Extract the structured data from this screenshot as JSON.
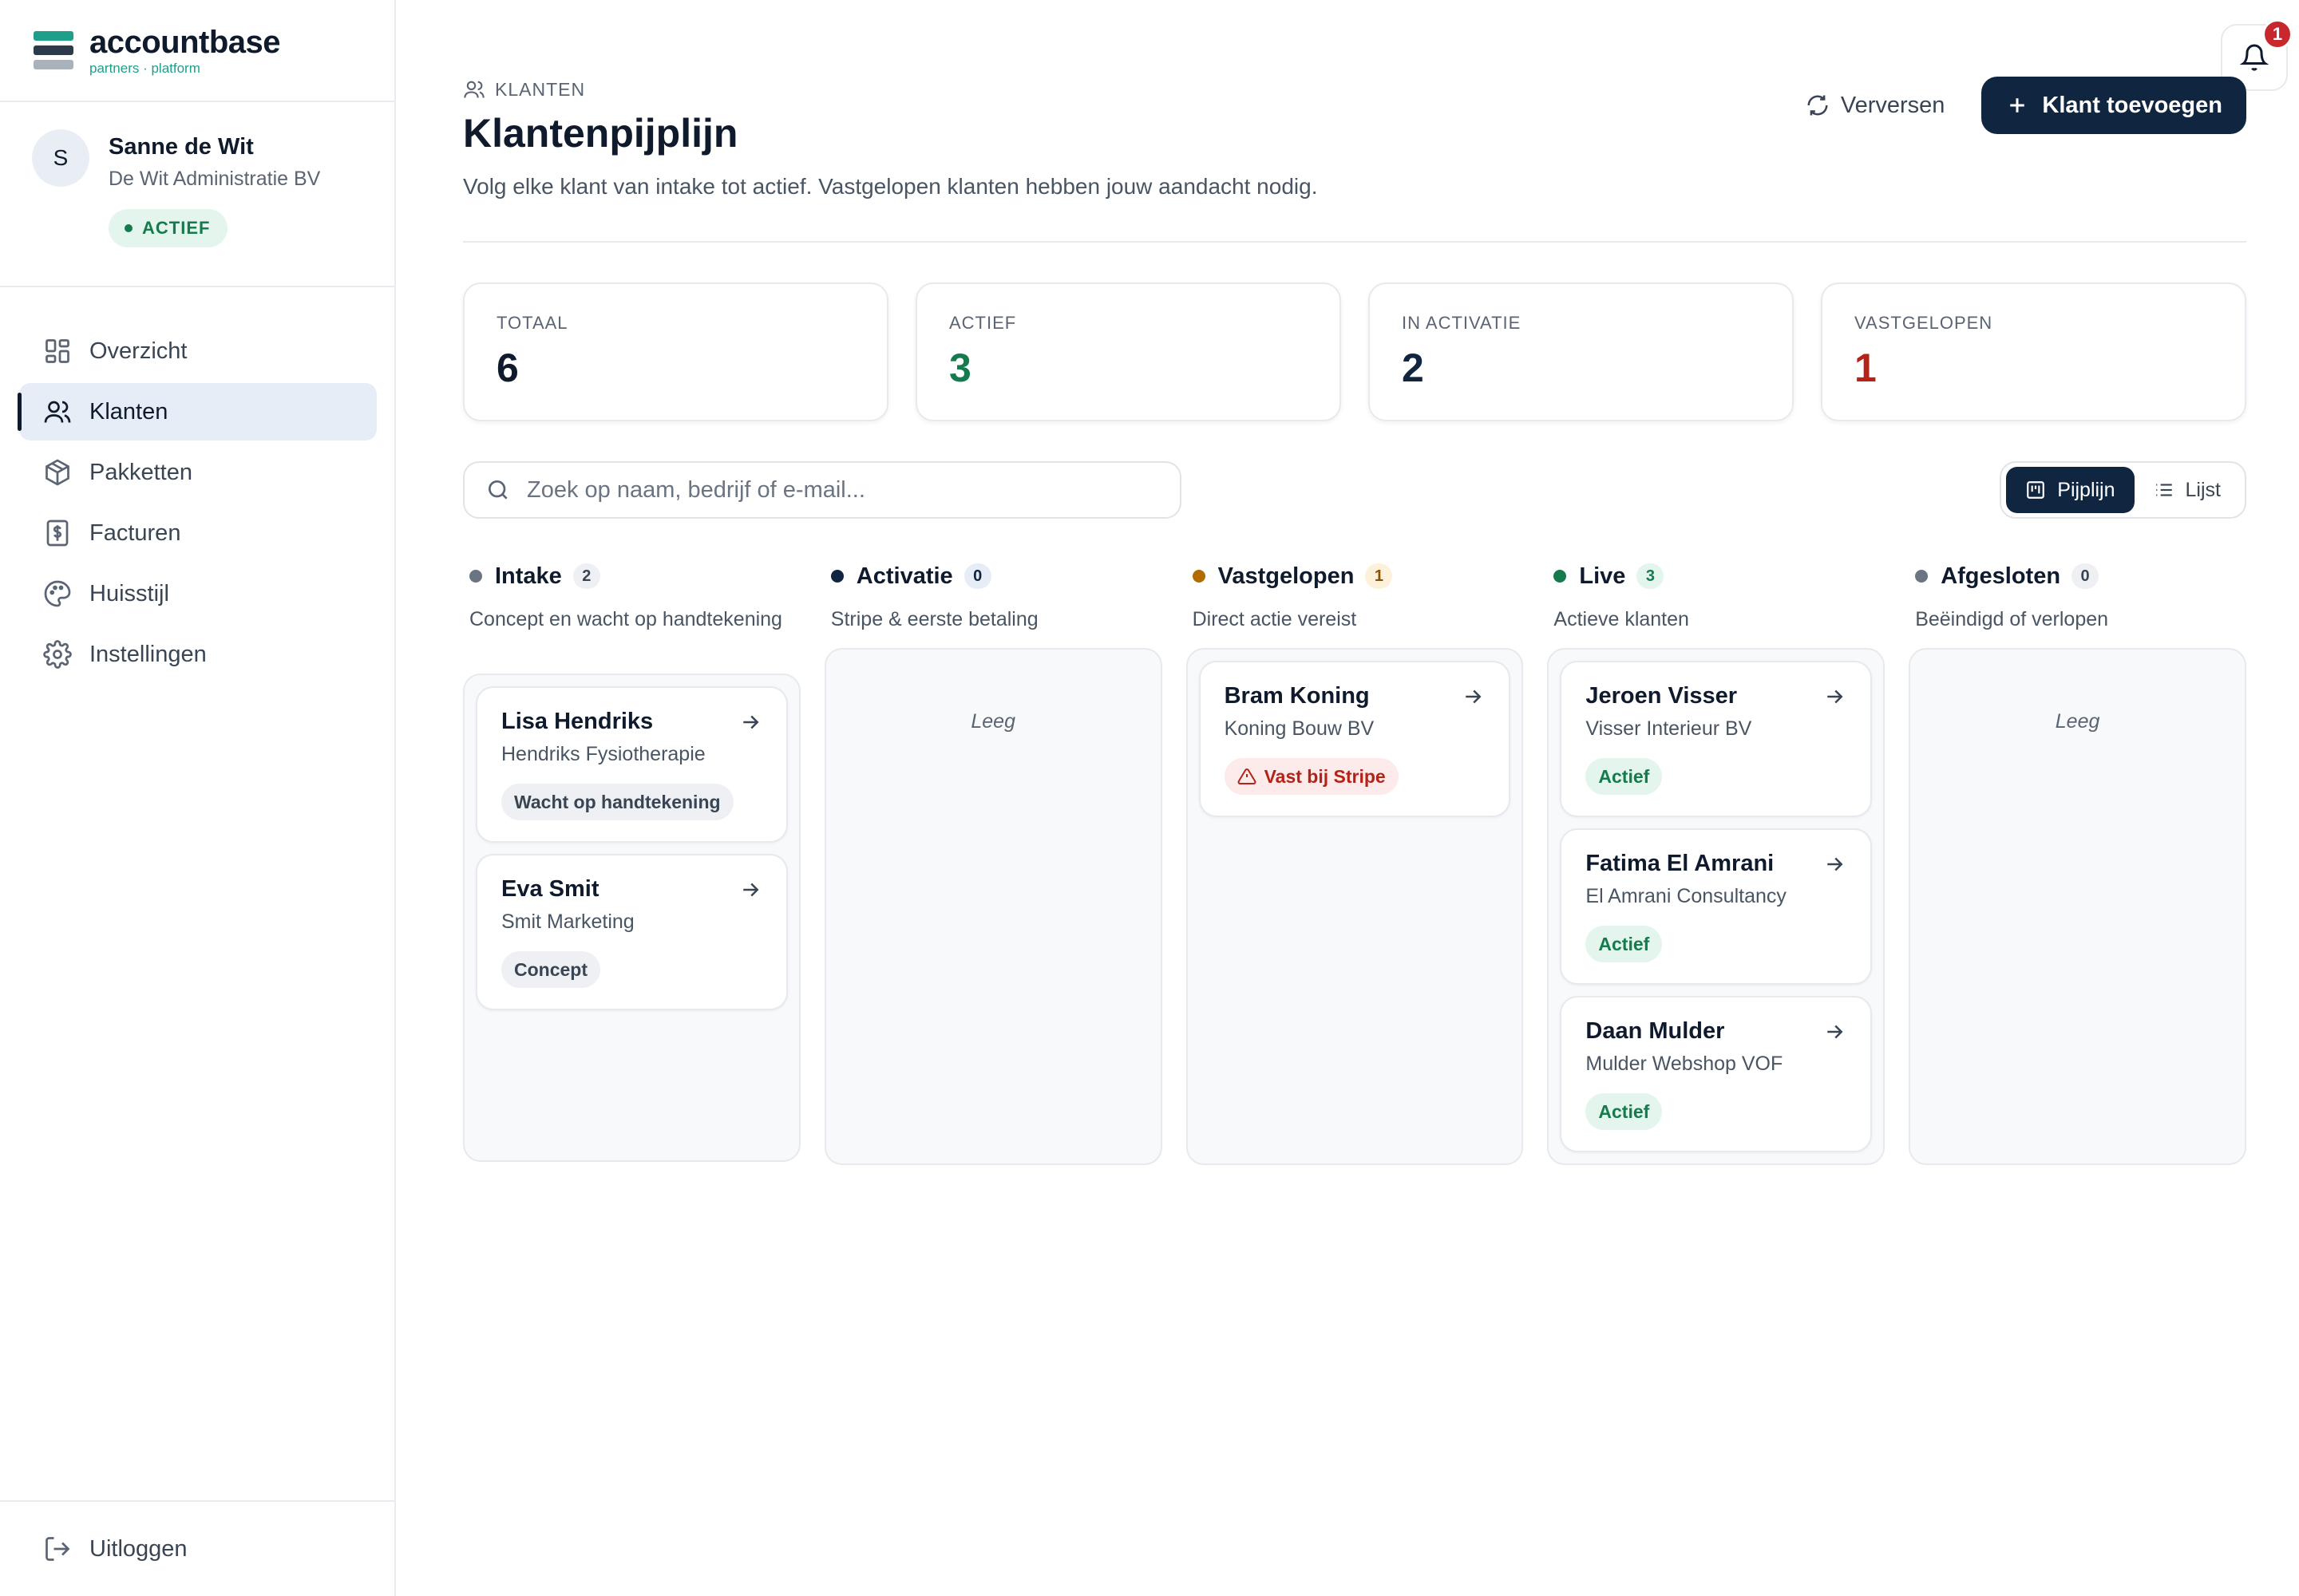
{
  "brand": {
    "name": "accountbase",
    "tagline": "partners · platform"
  },
  "user": {
    "initial": "S",
    "name": "Sanne de Wit",
    "company": "De Wit Administratie BV",
    "status": "ACTIEF"
  },
  "nav": {
    "items": [
      {
        "label": "Overzicht",
        "icon": "dashboard-icon"
      },
      {
        "label": "Klanten",
        "icon": "users-icon",
        "active": true
      },
      {
        "label": "Pakketten",
        "icon": "package-icon"
      },
      {
        "label": "Facturen",
        "icon": "invoice-icon"
      },
      {
        "label": "Huisstijl",
        "icon": "palette-icon"
      },
      {
        "label": "Instellingen",
        "icon": "gear-icon"
      }
    ],
    "logout": "Uitloggen"
  },
  "header": {
    "breadcrumb": "KLANTEN",
    "title": "Klantenpijplijn",
    "subtitle": "Volg elke klant van intake tot actief. Vastgelopen klanten hebben jouw aandacht nodig.",
    "refresh_label": "Verversen",
    "add_label": "Klant toevoegen",
    "notification_count": "1"
  },
  "stats": [
    {
      "label": "TOTAAL",
      "value": "6",
      "color": "#0f1b2d"
    },
    {
      "label": "ACTIEF",
      "value": "3",
      "color": "#157a4e"
    },
    {
      "label": "IN ACTIVATIE",
      "value": "2",
      "color": "#0f2540"
    },
    {
      "label": "VASTGELOPEN",
      "value": "1",
      "color": "#b42318"
    }
  ],
  "search": {
    "placeholder": "Zoek op naam, bedrijf of e-mail..."
  },
  "view_toggle": {
    "pipeline": "Pijplijn",
    "list": "Lijst"
  },
  "columns": [
    {
      "title": "Intake",
      "count": "2",
      "desc": "Concept en wacht op handtekening",
      "dot": "#6b7481",
      "count_bg": "#eef0f3",
      "count_fg": "#3a4554",
      "cards": [
        {
          "name": "Lisa Hendriks",
          "company": "Hendriks Fysiotherapie",
          "badge": "Wacht op handtekening",
          "badge_bg": "#eef0f3",
          "badge_fg": "#3a4554"
        },
        {
          "name": "Eva Smit",
          "company": "Smit Marketing",
          "badge": "Concept",
          "badge_bg": "#eef0f3",
          "badge_fg": "#3a4554"
        }
      ]
    },
    {
      "title": "Activatie",
      "count": "0",
      "desc": "Stripe & eerste betaling",
      "dot": "#0f2540",
      "count_bg": "#e6edf7",
      "count_fg": "#0f2540",
      "empty": "Leeg",
      "cards": []
    },
    {
      "title": "Vastgelopen",
      "count": "1",
      "desc": "Direct actie vereist",
      "dot": "#b36b00",
      "count_bg": "#fdf1dc",
      "count_fg": "#8a5300",
      "cards": [
        {
          "name": "Bram Koning",
          "company": "Koning Bouw BV",
          "badge": "Vast bij Stripe",
          "badge_bg": "#fdeaea",
          "badge_fg": "#b42318",
          "badge_icon": "warning-icon"
        }
      ]
    },
    {
      "title": "Live",
      "count": "3",
      "desc": "Actieve klanten",
      "dot": "#157a4e",
      "count_bg": "#e3f5ec",
      "count_fg": "#157a4e",
      "cards": [
        {
          "name": "Jeroen Visser",
          "company": "Visser Interieur BV",
          "badge": "Actief",
          "badge_bg": "#e3f5ec",
          "badge_fg": "#157a4e"
        },
        {
          "name": "Fatima El Amrani",
          "company": "El Amrani Consultancy",
          "badge": "Actief",
          "badge_bg": "#e3f5ec",
          "badge_fg": "#157a4e"
        },
        {
          "name": "Daan Mulder",
          "company": "Mulder Webshop VOF",
          "badge": "Actief",
          "badge_bg": "#e3f5ec",
          "badge_fg": "#157a4e"
        }
      ]
    },
    {
      "title": "Afgesloten",
      "count": "0",
      "desc": "Beëindigd of verlopen",
      "dot": "#6b7481",
      "count_bg": "#eef0f3",
      "count_fg": "#3a4554",
      "empty": "Leeg",
      "cards": []
    }
  ]
}
